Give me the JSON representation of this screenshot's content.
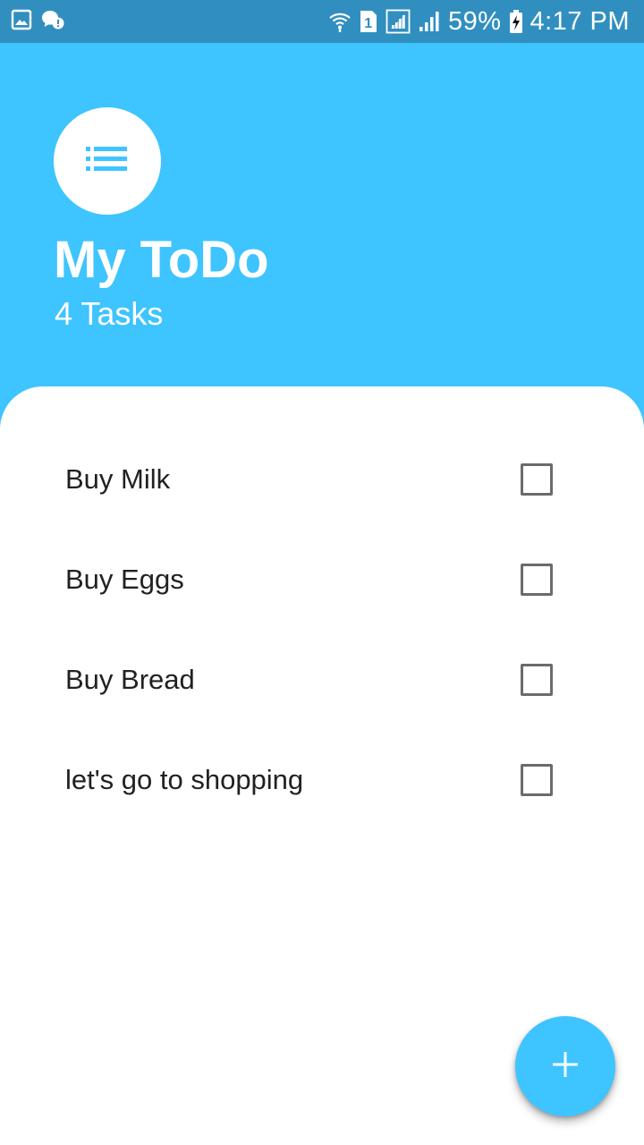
{
  "status_bar": {
    "battery_percent": "59%",
    "time": "4:17 PM",
    "sim_slot": "1",
    "icons": [
      "gallery-icon",
      "chat-alert-icon",
      "wifi-icon",
      "sim-1-icon",
      "signal-icon",
      "signal-icon",
      "battery-charging-icon"
    ]
  },
  "header": {
    "logo_icon": "list-icon",
    "title": "My ToDo",
    "task_count": "4 Tasks"
  },
  "todos": [
    {
      "label": "Buy Milk",
      "checked": false
    },
    {
      "label": "Buy Eggs",
      "checked": false
    },
    {
      "label": "Buy Bread",
      "checked": false
    },
    {
      "label": "let's go to shopping",
      "checked": false
    }
  ],
  "fab": {
    "icon": "plus-icon"
  },
  "colors": {
    "accent": "#3ec4ff",
    "status_bar": "#318fc0",
    "panel": "#ffffff",
    "text": "#212121",
    "checkbox_border": "#6b6b6b"
  }
}
